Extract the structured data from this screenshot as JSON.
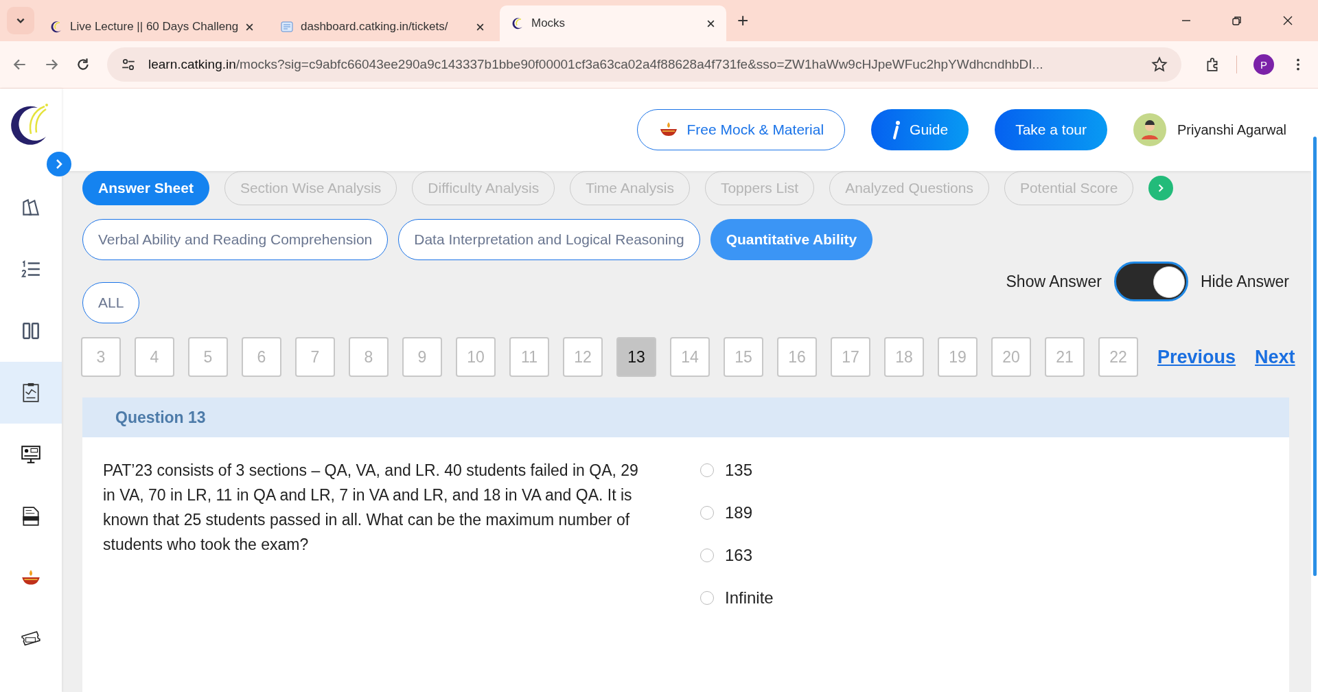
{
  "browser": {
    "tabs": [
      {
        "title": "Live Lecture || 60 Days Challeng",
        "selected": false,
        "kind": "logo"
      },
      {
        "title": "dashboard.catking.in/tickets/",
        "selected": false,
        "kind": "page"
      },
      {
        "title": "Mocks",
        "selected": true,
        "kind": "logo"
      }
    ],
    "new_tab": "+",
    "url_host": "learn.catking.in",
    "url_rest": "/mocks?sig=c9abfc66043ee290a9c143337b1bbe90f00001cf3a63ca02a4f88628a4f731fe&sso=ZW1haWw9cHJpeWFuc2hpYWdhcndhbDI...",
    "profile": "P"
  },
  "sidebar": {
    "items": [
      {
        "kind": "swatch",
        "selected": false
      },
      {
        "kind": "list",
        "selected": false
      },
      {
        "kind": "columns",
        "selected": false
      },
      {
        "kind": "report",
        "selected": true
      },
      {
        "kind": "lecture",
        "selected": false
      },
      {
        "kind": "ebook",
        "selected": false
      },
      {
        "kind": "diya",
        "selected": false
      },
      {
        "kind": "ticket",
        "selected": false
      }
    ]
  },
  "header": {
    "buttons": [
      {
        "label": "Free Mock & Material",
        "kind": "outline"
      },
      {
        "label": "Guide",
        "kind": "info"
      },
      {
        "label": "Take a tour",
        "kind": "solid"
      }
    ],
    "user": "Priyanshi Agarwal"
  },
  "analysis_tabs": [
    {
      "label": "Answer Sheet",
      "selected": true
    },
    {
      "label": "Section Wise Analysis",
      "selected": false
    },
    {
      "label": "Difficulty Analysis",
      "selected": false
    },
    {
      "label": "Time Analysis",
      "selected": false
    },
    {
      "label": "Toppers List",
      "selected": false
    },
    {
      "label": "Analyzed Questions",
      "selected": false
    },
    {
      "label": "Potential Score",
      "selected": false
    }
  ],
  "sections": [
    {
      "label": "Verbal Ability and Reading Comprehension",
      "selected": false
    },
    {
      "label": "Data Interpretation and Logical Reasoning",
      "selected": false
    },
    {
      "label": "Quantitative Ability",
      "selected": true
    }
  ],
  "filter": {
    "label": "ALL",
    "selected": false
  },
  "answer_toggle": {
    "off_label": "Show Answer",
    "on_label": "Hide Answer",
    "on": true
  },
  "question_numbers": [
    {
      "label": "3",
      "selected": false
    },
    {
      "label": "4",
      "selected": false
    },
    {
      "label": "5",
      "selected": false
    },
    {
      "label": "6",
      "selected": false
    },
    {
      "label": "7",
      "selected": false
    },
    {
      "label": "8",
      "selected": false
    },
    {
      "label": "9",
      "selected": false
    },
    {
      "label": "10",
      "selected": false
    },
    {
      "label": "11",
      "selected": false
    },
    {
      "label": "12",
      "selected": false
    },
    {
      "label": "13",
      "selected": true
    },
    {
      "label": "14",
      "selected": false
    },
    {
      "label": "15",
      "selected": false
    },
    {
      "label": "16",
      "selected": false
    },
    {
      "label": "17",
      "selected": false
    },
    {
      "label": "18",
      "selected": false
    },
    {
      "label": "19",
      "selected": false
    },
    {
      "label": "20",
      "selected": false
    },
    {
      "label": "21",
      "selected": false
    },
    {
      "label": "22",
      "selected": false
    }
  ],
  "previous": "Previous",
  "next": "Next",
  "question": {
    "title": "Question 13",
    "text": "PAT’23 consists of 3 sections – QA, VA, and LR. 40 students failed in QA, 29 in VA, 70 in LR, 11 in QA and LR, 7 in VA and LR, and 18 in VA and QA. It is known that 25 students passed in all. What can be the maximum number of students who took the exam?",
    "options": [
      {
        "label": "135",
        "selected": false
      },
      {
        "label": "189",
        "selected": false
      },
      {
        "label": "163",
        "selected": false
      },
      {
        "label": "Infinite",
        "selected": false
      }
    ]
  }
}
